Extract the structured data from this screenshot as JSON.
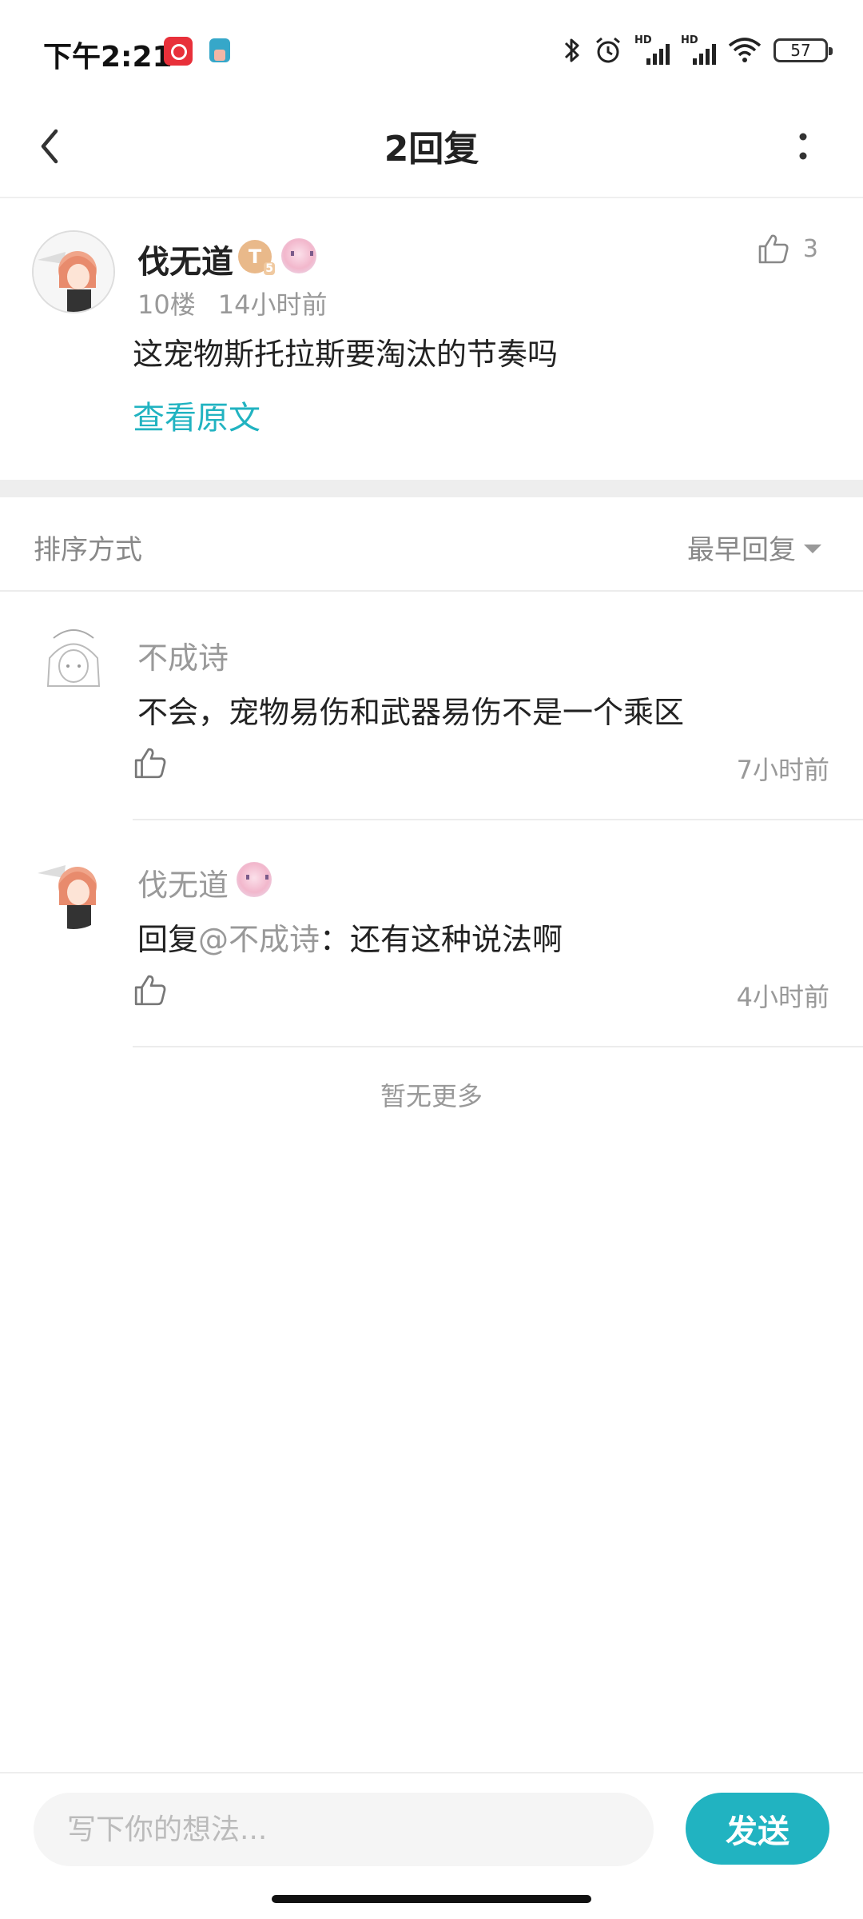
{
  "status_bar": {
    "time": "下午2:21",
    "battery": "57",
    "hd1": "HD",
    "hd2": "HD"
  },
  "header": {
    "title": "2回复"
  },
  "post": {
    "author": "伐无道",
    "level_badge": "T",
    "level_num": "5",
    "floor": "10楼",
    "time": "14小时前",
    "likes": "3",
    "content": "这宠物斯托拉斯要淘汰的节奏吗",
    "view_original": "查看原文"
  },
  "sort": {
    "label": "排序方式",
    "value": "最早回复"
  },
  "replies": [
    {
      "author": "不成诗",
      "content": "不会，宠物易伤和武器易伤不是一个乘区",
      "time": "7小时前"
    },
    {
      "author": "伐无道",
      "prefix": "回复",
      "mention": "@不成诗",
      "content": "：还有这种说法啊",
      "time": "4小时前"
    }
  ],
  "no_more": "暂无更多",
  "input": {
    "placeholder": "写下你的想法..."
  },
  "send_label": "发送",
  "colors": {
    "accent": "#21b3c1",
    "muted_text": "#999999",
    "divider": "#eeeeee"
  },
  "icons": [
    "back-arrow-icon",
    "more-vertical-icon",
    "thumbs-up-icon",
    "bluetooth-icon",
    "alarm-icon",
    "wifi-icon",
    "battery-icon"
  ]
}
